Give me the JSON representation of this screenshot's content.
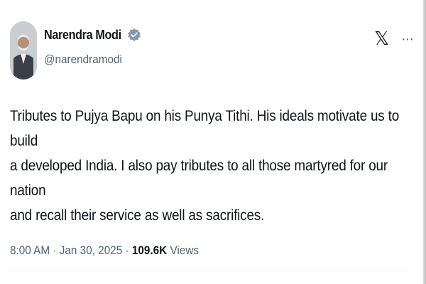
{
  "author": {
    "display_name": "Narendra Modi",
    "handle": "@narendramodi",
    "verified_icon": "verified-badge-icon",
    "avatar_icon": "avatar"
  },
  "actions": {
    "x_logo": "𝕏",
    "more": "···"
  },
  "tweet": {
    "lines": [
      "Tributes to Pujya Bapu on his Punya Tithi. His ideals motivate us to build",
      "a developed India. I also pay tributes to all those martyred for our nation",
      "and recall their service as well as sacrifices."
    ]
  },
  "meta": {
    "time": "8:00 AM",
    "separator": "·",
    "date": "Jan 30, 2025",
    "views_count": "109.6K",
    "views_label": "Views"
  },
  "colors": {
    "text": "#0f1419",
    "secondary": "#536471",
    "verified": "#829aab"
  }
}
